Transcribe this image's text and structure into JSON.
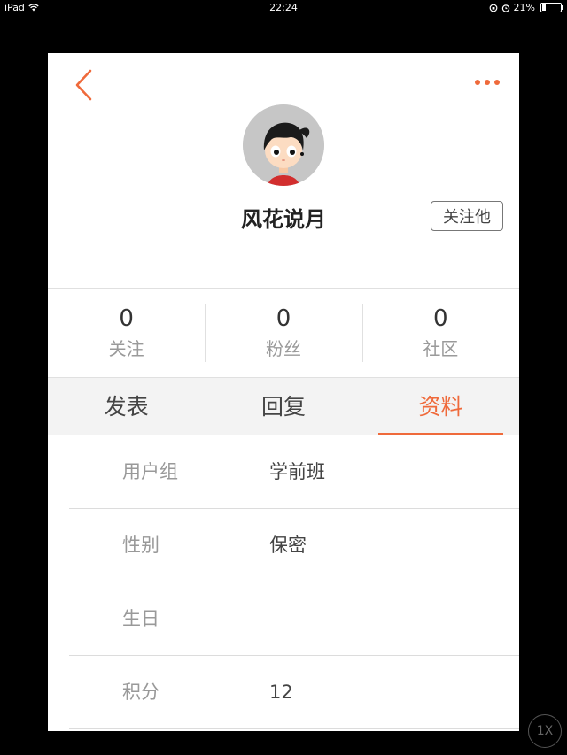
{
  "status_bar": {
    "device": "iPad",
    "time": "22:24",
    "battery_pct": "21%",
    "battery_level": 0.21
  },
  "profile": {
    "username": "风花说月",
    "follow_label": "关注他"
  },
  "stats": [
    {
      "value": "0",
      "label": "关注"
    },
    {
      "value": "0",
      "label": "粉丝"
    },
    {
      "value": "0",
      "label": "社区"
    }
  ],
  "tabs": [
    {
      "label": "发表",
      "active": false
    },
    {
      "label": "回复",
      "active": false
    },
    {
      "label": "资料",
      "active": true
    }
  ],
  "info_rows": [
    {
      "label": "用户组",
      "value": "学前班"
    },
    {
      "label": "性别",
      "value": "保密"
    },
    {
      "label": "生日",
      "value": ""
    },
    {
      "label": "积分",
      "value": "12"
    }
  ],
  "zoom_label": "1X",
  "colors": {
    "accent": "#ef6a3b",
    "background": "#000000",
    "card": "#ffffff"
  }
}
